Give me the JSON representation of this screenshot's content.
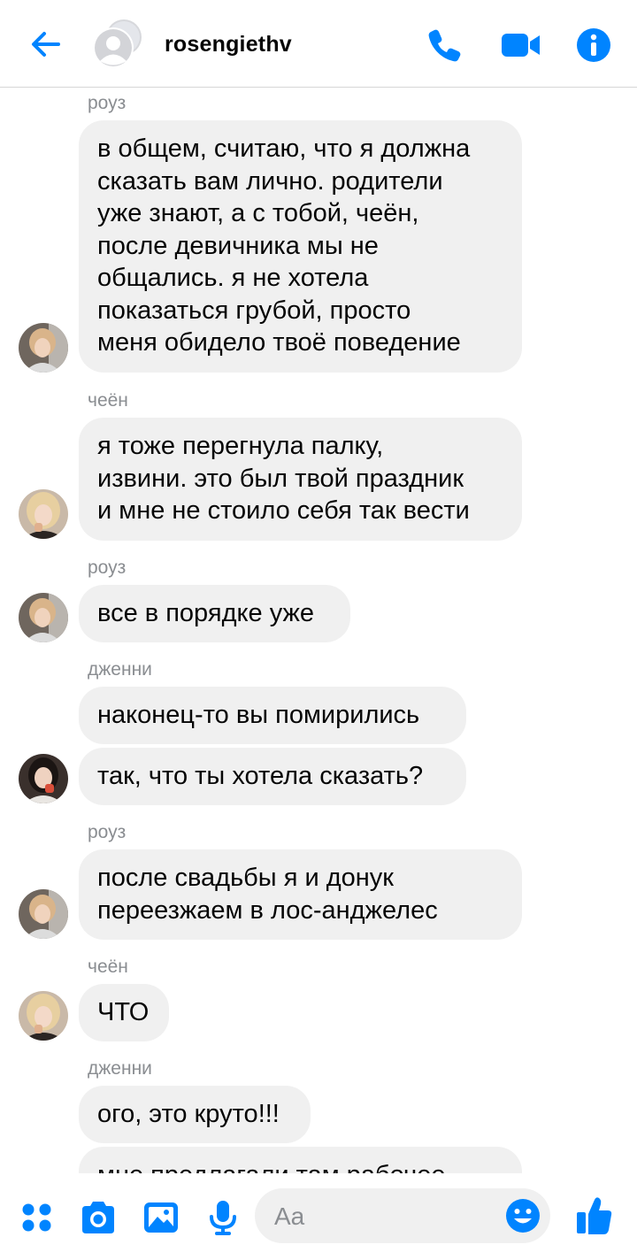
{
  "header": {
    "title": "rosengiethv"
  },
  "colors": {
    "accent": "#0084ff",
    "bubble": "#f0f0f0",
    "sender_label": "#8a8d91"
  },
  "messages": [
    {
      "sender": "роуз",
      "lines": [
        "в общем, считаю, что я должна",
        "сказать вам лично. родители",
        "уже знают, а с тобой, чеён,",
        "после девичника мы не",
        "общались. я не хотела",
        "показаться грубой, просто",
        "меня обидело твоё поведение"
      ]
    },
    {
      "sender": "чеён",
      "lines": [
        "я тоже перегнула палку,",
        "извини. это был твой праздник",
        "и мне не стоило себя так вести"
      ]
    },
    {
      "sender": "роуз",
      "lines": [
        "все в порядке уже"
      ]
    },
    {
      "sender": "дженни",
      "lines": [
        "наконец-то вы помирились"
      ]
    },
    {
      "sender": "",
      "lines": [
        "так, что ты хотела сказать?"
      ]
    },
    {
      "sender": "роуз",
      "lines": [
        "после свадьбы я и донук",
        "переезжаем в лос-анджелес"
      ]
    },
    {
      "sender": "чеён",
      "lines": [
        "ЧТО"
      ]
    },
    {
      "sender": "дженни",
      "lines": [
        "ого, это круто!!!"
      ]
    },
    {
      "sender": "",
      "lines": [
        "мне предлагали там рабочее"
      ]
    }
  ],
  "composer": {
    "placeholder": "Aa"
  },
  "icons": {
    "back": "arrow-left-icon",
    "call": "phone-icon",
    "video": "video-camera-icon",
    "info": "info-icon",
    "menu": "four-dots-icon",
    "camera": "camera-icon",
    "gallery": "image-icon",
    "mic": "microphone-icon",
    "emoji": "smiley-icon",
    "like": "thumbs-up-icon"
  }
}
